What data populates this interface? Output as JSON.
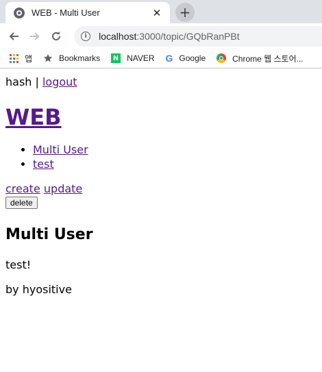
{
  "browser": {
    "tab_title": "WEB - Multi User",
    "tab_close": "✕",
    "new_tab": "+",
    "url_host": "localhost",
    "url_path": ":3000/topic/GQbRanPBt",
    "bookmarks": [
      {
        "label": "앱",
        "icon": "apps-grid-icon"
      },
      {
        "label": "Bookmarks",
        "icon": "star-icon"
      },
      {
        "label": "NAVER",
        "icon": "naver-icon"
      },
      {
        "label": "Google",
        "icon": "google-icon"
      },
      {
        "label": "Chrome 웹 스토어...",
        "icon": "chrome-webstore-icon"
      }
    ],
    "icon_glyphs": {
      "naver": "N",
      "google": "G",
      "info": "i"
    }
  },
  "page": {
    "auth_user": "hash",
    "auth_separator": " | ",
    "logout_label": "logout",
    "site_title": "WEB",
    "topics": [
      "Multi User",
      "test"
    ],
    "create_label": "create",
    "update_label": "update",
    "delete_label": "delete",
    "topic_title": "Multi User",
    "topic_description": "test!",
    "byline": "by hyositive"
  },
  "colors": {
    "link_visited": "#551a8b",
    "tabstrip_bg": "#dee1e6",
    "omnibox_bg": "#f1f3f4"
  }
}
